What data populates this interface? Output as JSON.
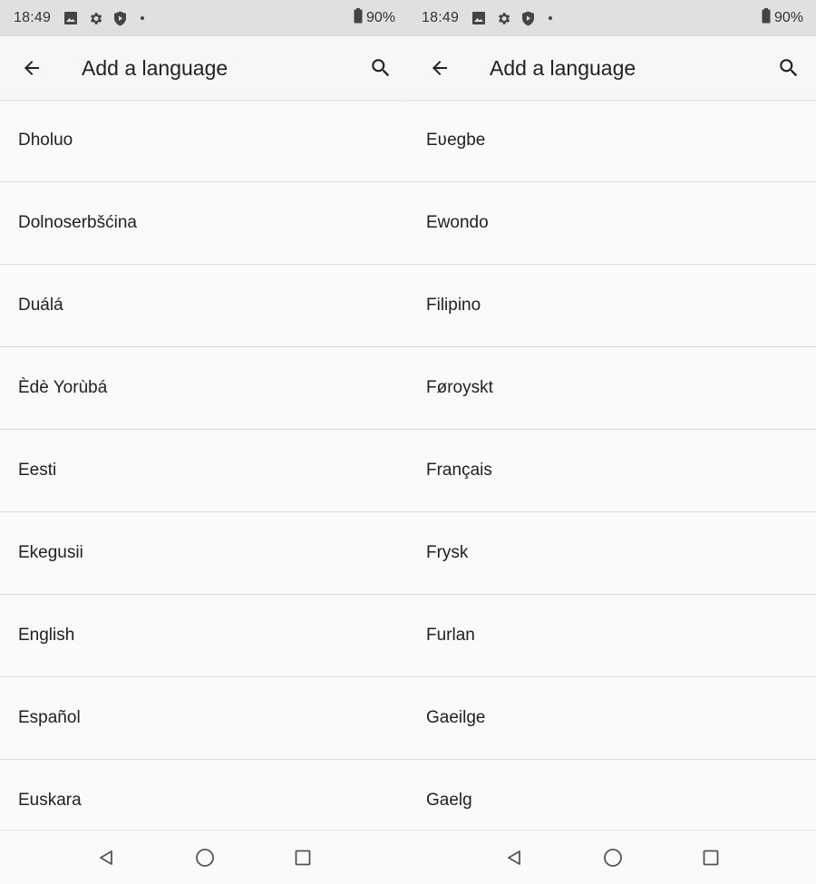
{
  "screens": [
    {
      "status": {
        "time": "18:49",
        "battery": "90%"
      },
      "app_bar": {
        "title": "Add a language"
      },
      "languages": [
        "Dholuo",
        "Dolnoserbšćina",
        "Duálá",
        "Èdè Yorùbá",
        "Eesti",
        "Ekegusii",
        "English",
        "Español",
        "Euskara"
      ]
    },
    {
      "status": {
        "time": "18:49",
        "battery": "90%"
      },
      "app_bar": {
        "title": "Add a language"
      },
      "languages": [
        "Eʋegbe",
        "Ewondo",
        "Filipino",
        "Føroyskt",
        "Français",
        "Frysk",
        "Furlan",
        "Gaeilge",
        "Gaelg"
      ]
    }
  ],
  "icons": {
    "status": [
      "image-icon",
      "gear-icon",
      "shield-icon",
      "notification-dot-icon",
      "battery-icon"
    ],
    "app_bar": [
      "back-arrow-icon",
      "search-icon"
    ],
    "nav": [
      "nav-back-icon",
      "nav-home-icon",
      "nav-recents-icon"
    ]
  }
}
